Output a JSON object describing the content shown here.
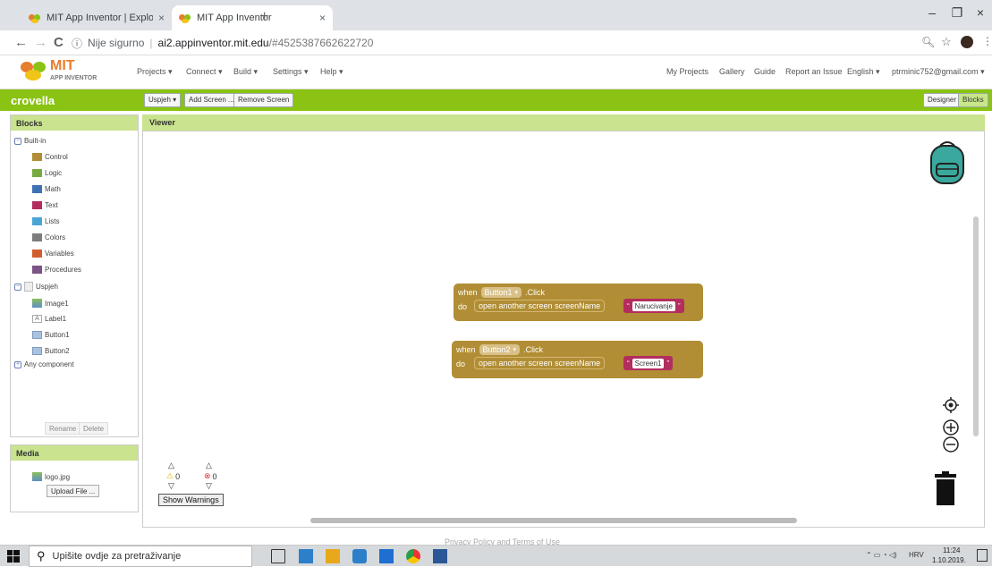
{
  "browser": {
    "tabs": [
      {
        "title": "MIT App Inventor | Explore MIT A",
        "active": false
      },
      {
        "title": "MIT App Inventor",
        "active": true
      }
    ],
    "tab_close_glyph": "×",
    "new_tab_glyph": "+",
    "window_controls": [
      "–",
      "❐",
      "×"
    ],
    "nav": {
      "back": "←",
      "forward": "→",
      "reload": "C"
    },
    "security_label": "Nije sigurno",
    "url_host": "ai2.appinventor.mit.edu",
    "url_path": "/#4525387662622720",
    "toolbar_icons": [
      "zoom-icon",
      "star-icon",
      "profile-avatar",
      "menu-dots-icon"
    ]
  },
  "appinventor": {
    "brand": {
      "mit": "MIT",
      "sub": "APP INVENTOR"
    },
    "menus": [
      "Projects ▾",
      "Connect ▾",
      "Build ▾",
      "Settings ▾",
      "Help ▾"
    ],
    "right_links": [
      "My Projects",
      "Gallery",
      "Guide",
      "Report an Issue",
      "English ▾",
      "ptrminic752@gmail.com ▾"
    ],
    "project_name": "crovella",
    "screen_select": "Uspjeh ▾",
    "add_screen": "Add Screen ...",
    "remove_screen": "Remove Screen",
    "designer": "Designer",
    "blocks": "Blocks",
    "colors": {
      "green": "#8ac313",
      "panel_head": "#c9e38e",
      "event_block": "#b18e35",
      "text_block": "#b32d5e"
    }
  },
  "blocks_panel": {
    "title": "Blocks",
    "builtin_label": "Built-in",
    "builtin": [
      {
        "label": "Control",
        "color": "#b18e35"
      },
      {
        "label": "Logic",
        "color": "#77ab41"
      },
      {
        "label": "Math",
        "color": "#3f71b5"
      },
      {
        "label": "Text",
        "color": "#b32d5e"
      },
      {
        "label": "Lists",
        "color": "#49a6d4"
      },
      {
        "label": "Colors",
        "color": "#7d7d7d"
      },
      {
        "label": "Variables",
        "color": "#d05f2d"
      },
      {
        "label": "Procedures",
        "color": "#7c5385"
      }
    ],
    "screen_label": "Uspjeh",
    "components": [
      "Image1",
      "Label1",
      "Button1",
      "Button2"
    ],
    "any_component": "Any component",
    "rename": "Rename",
    "delete": "Delete"
  },
  "media": {
    "title": "Media",
    "file": "logo.jpg",
    "upload": "Upload File ..."
  },
  "viewer": {
    "title": "Viewer",
    "event1": {
      "when": "when",
      "component": "Button1",
      "event": ".Click",
      "do": "do",
      "call": "open another screen",
      "param": "screenName",
      "value": "Narucivanje"
    },
    "event2": {
      "when": "when",
      "component": "Button2",
      "event": ".Click",
      "do": "do",
      "call": "open another screen",
      "param": "screenName",
      "value": "Screen1"
    },
    "warnings_count": "0",
    "errors_count": "0",
    "show_warnings": "Show Warnings"
  },
  "footer": "Privacy Policy and Terms of Use",
  "taskbar": {
    "search_placeholder": "Upišite ovdje za pretraživanje",
    "lang": "HRV",
    "time": "11:24",
    "date": "1.10.2019."
  }
}
